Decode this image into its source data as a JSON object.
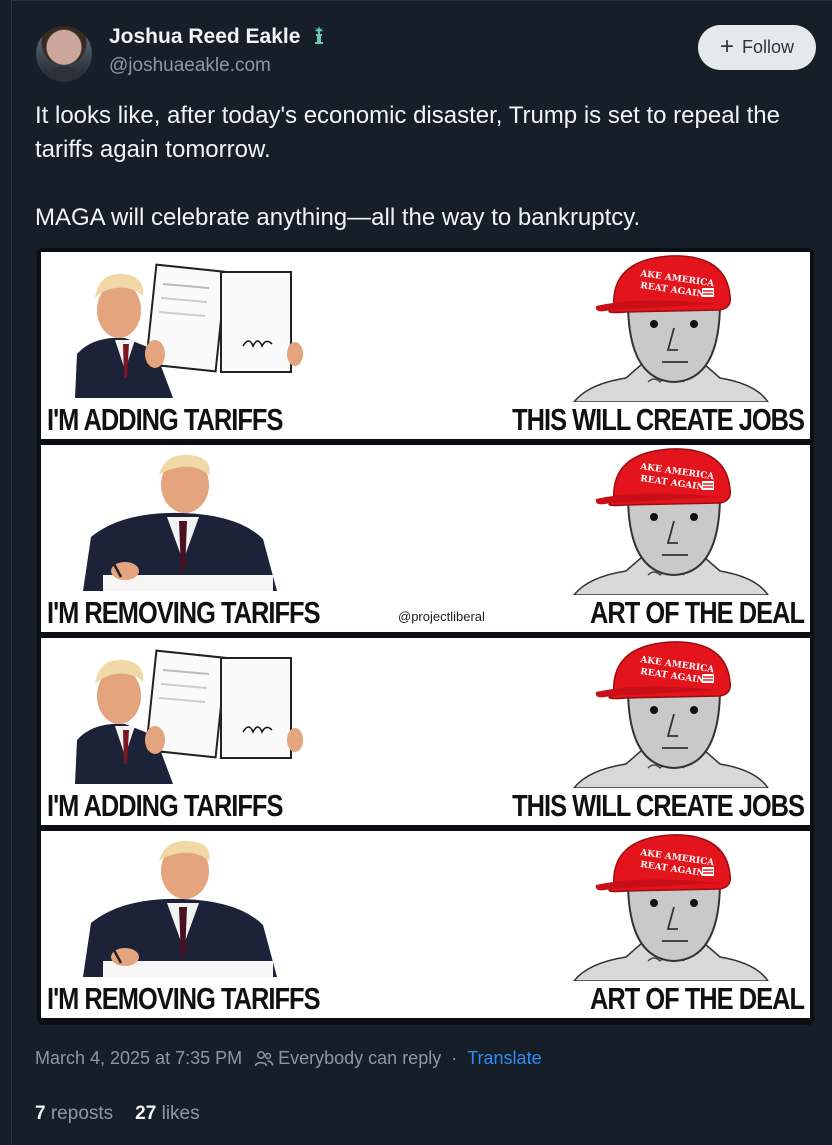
{
  "author": {
    "display_name": "Joshua Reed Eakle",
    "handle": "@joshuaeakle.com",
    "badge_icon": "statue-of-liberty-icon"
  },
  "follow_button": {
    "label": "Follow",
    "icon": "plus-icon"
  },
  "post": {
    "paragraphs": [
      "It looks like, after today's economic disaster, Trump is set to repeal the tariffs again tomorrow.",
      "MAGA will celebrate anything—all the way to bankruptcy."
    ]
  },
  "meme": {
    "watermark": "@projectliberal",
    "panels": [
      {
        "left_caption": "I'M ADDING TARIFFS",
        "right_caption": "THIS WILL CREATE JOBS",
        "left_image": "trump-holding-signed-order",
        "right_image": "npc-maga-hat"
      },
      {
        "left_caption": "I'M REMOVING TARIFFS",
        "right_caption": "ART OF THE DEAL",
        "left_image": "trump-signing-document",
        "right_image": "npc-maga-hat"
      },
      {
        "left_caption": "I'M ADDING TARIFFS",
        "right_caption": "THIS WILL CREATE JOBS",
        "left_image": "trump-holding-signed-order",
        "right_image": "npc-maga-hat"
      },
      {
        "left_caption": "I'M REMOVING TARIFFS",
        "right_caption": "ART OF THE DEAL",
        "left_image": "trump-signing-document",
        "right_image": "npc-maga-hat"
      }
    ],
    "hat_text": [
      "AKE AMERICA",
      "REAT AGAIN"
    ]
  },
  "meta": {
    "timestamp": "March 4, 2025 at 7:35 PM",
    "reply_setting": "Everybody can reply",
    "separator": "·",
    "translate": "Translate"
  },
  "stats": {
    "reposts_count": "7",
    "reposts_label": "reposts",
    "likes_count": "27",
    "likes_label": "likes"
  },
  "colors": {
    "background": "#161e27",
    "text": "#f1f3f5",
    "muted": "#8b98a5",
    "link": "#2f8bf5",
    "follow_bg": "#e6e9ec"
  }
}
